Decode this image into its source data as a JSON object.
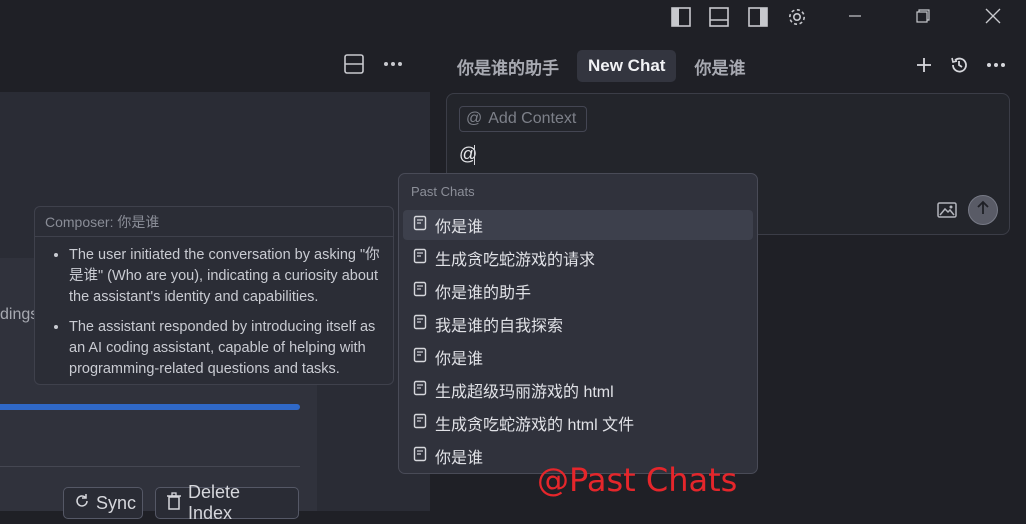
{
  "left": {
    "partial_text": "dings",
    "sync_label": "Sync",
    "delete_label": "Delete Index"
  },
  "tabs": [
    {
      "label": "你是谁的助手"
    },
    {
      "label": "New Chat"
    },
    {
      "label": "你是谁"
    }
  ],
  "composer": {
    "add_context": "Add Context",
    "input_value": "@"
  },
  "tooltip": {
    "title": "Composer: 你是谁",
    "bullets": [
      "The user initiated the conversation by asking \"你是谁\" (Who are you), indicating a curiosity about the assistant's identity and capabilities.",
      "The assistant responded by introducing itself as an AI coding assistant, capable of helping with programming-related questions and tasks."
    ]
  },
  "menu": {
    "header": "Past Chats",
    "items": [
      {
        "label": "你是谁"
      },
      {
        "label": "生成贪吃蛇游戏的请求"
      },
      {
        "label": "你是谁的助手"
      },
      {
        "label": "我是谁的自我探索"
      },
      {
        "label": "你是谁"
      },
      {
        "label": "生成超级玛丽游戏的 html"
      },
      {
        "label": "生成贪吃蛇游戏的 html 文件"
      },
      {
        "label": "你是谁"
      }
    ]
  },
  "watermark": "@Past Chats",
  "colors": {
    "accent": "#2f68c7",
    "watermark": "#e5262b",
    "background": "#1f2026"
  }
}
